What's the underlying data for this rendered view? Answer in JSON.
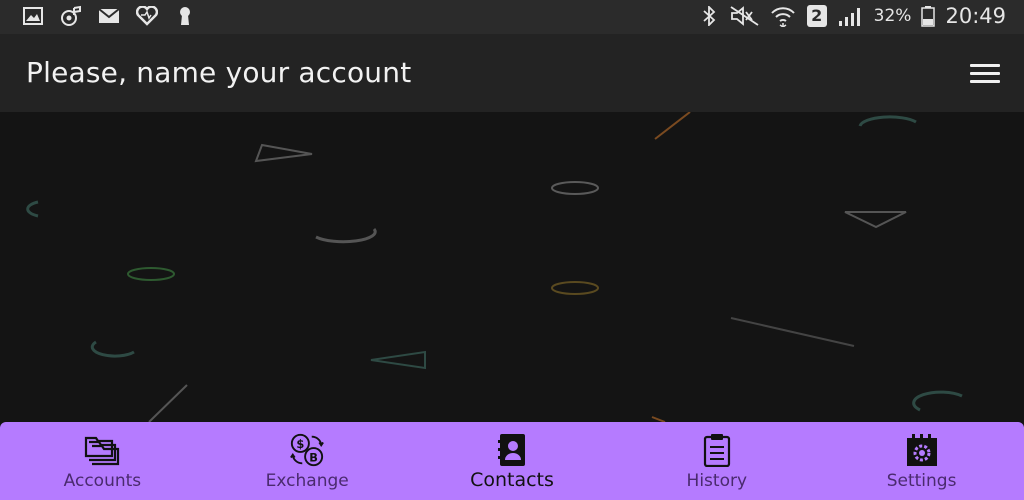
{
  "statusbar": {
    "battery": "32%",
    "time": "20:49",
    "sim_badge": "2",
    "left_icons": [
      "image-icon",
      "music-icon",
      "mail-icon",
      "heart-icon",
      "keyhole-icon"
    ],
    "right_icons": [
      "bluetooth-icon",
      "mute-icon",
      "wifi-icon",
      "sim-icon",
      "signal-icon",
      "battery-icon"
    ]
  },
  "appbar": {
    "title": "Please, name your account",
    "menu_icon": "hamburger-icon"
  },
  "bottom_nav": {
    "accent_color": "#b57bff",
    "items": [
      {
        "label": "Accounts",
        "icon": "folders-icon"
      },
      {
        "label": "Exchange",
        "icon": "currency-exchange-icon"
      },
      {
        "label": "Contacts",
        "icon": "contact-book-icon"
      },
      {
        "label": "History",
        "icon": "clipboard-icon"
      },
      {
        "label": "Settings",
        "icon": "calendar-gear-icon"
      }
    ]
  }
}
